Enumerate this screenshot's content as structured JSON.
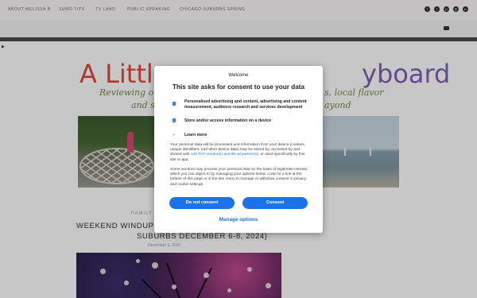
{
  "nav": {
    "items": [
      "ABOUT MELISSA B",
      "SUMO TIPS",
      "TV LAND",
      "PUBLIC SPEAKING",
      "CHICAGO SUBURBS SPRING"
    ],
    "social_icons": [
      "facebook-icon",
      "twitter-icon",
      "pinterest-icon",
      "instagram-icon",
      "youtube-icon"
    ]
  },
  "blog": {
    "title_start": "A Little",
    "title_end": "yboard",
    "tagline_line1_left": "Reviewing ou",
    "tagline_line1_right": "s, local flavor",
    "tagline_line2_left": "and st",
    "tagline_line2_right": "ayond",
    "post_category": "FAMILY",
    "post_title_line1": "WEEKEND WINDUP (FA",
    "post_title_line2": "SUBURBS DECEMBER 6-8, 2024)",
    "post_meta": "December 5, 2024"
  },
  "consent": {
    "welcome": "Welcome",
    "heading": "This site asks for consent to use your data",
    "purposes": [
      {
        "icon": "person-data-icon",
        "text": "Personalised advertising and content, advertising and content measurement, audience research and services development"
      },
      {
        "icon": "device-storage-icon",
        "text": "Store and/or access information on a device"
      }
    ],
    "learn_more": "Learn more",
    "paragraph1_a": "Your personal data will be processed and information from your device (cookies, unique identifiers, and other device data) may be stored by, accessed by and shared with ",
    "paragraph1_link": "142 TCF vendor(s) and 68 ad partner(s)",
    "paragraph1_b": ", or used specifically by this site or app.",
    "paragraph2": "Some vendors may process your personal data on the basis of legitimate interest, which you can object to by managing your options below. Look for a link at the bottom of this page or in the site menu to manage or withdraw consent in privacy and cookie settings.",
    "do_not_consent": "Do not consent",
    "consent": "Consent",
    "manage_options": "Manage options",
    "accent": "#1a73e8"
  }
}
